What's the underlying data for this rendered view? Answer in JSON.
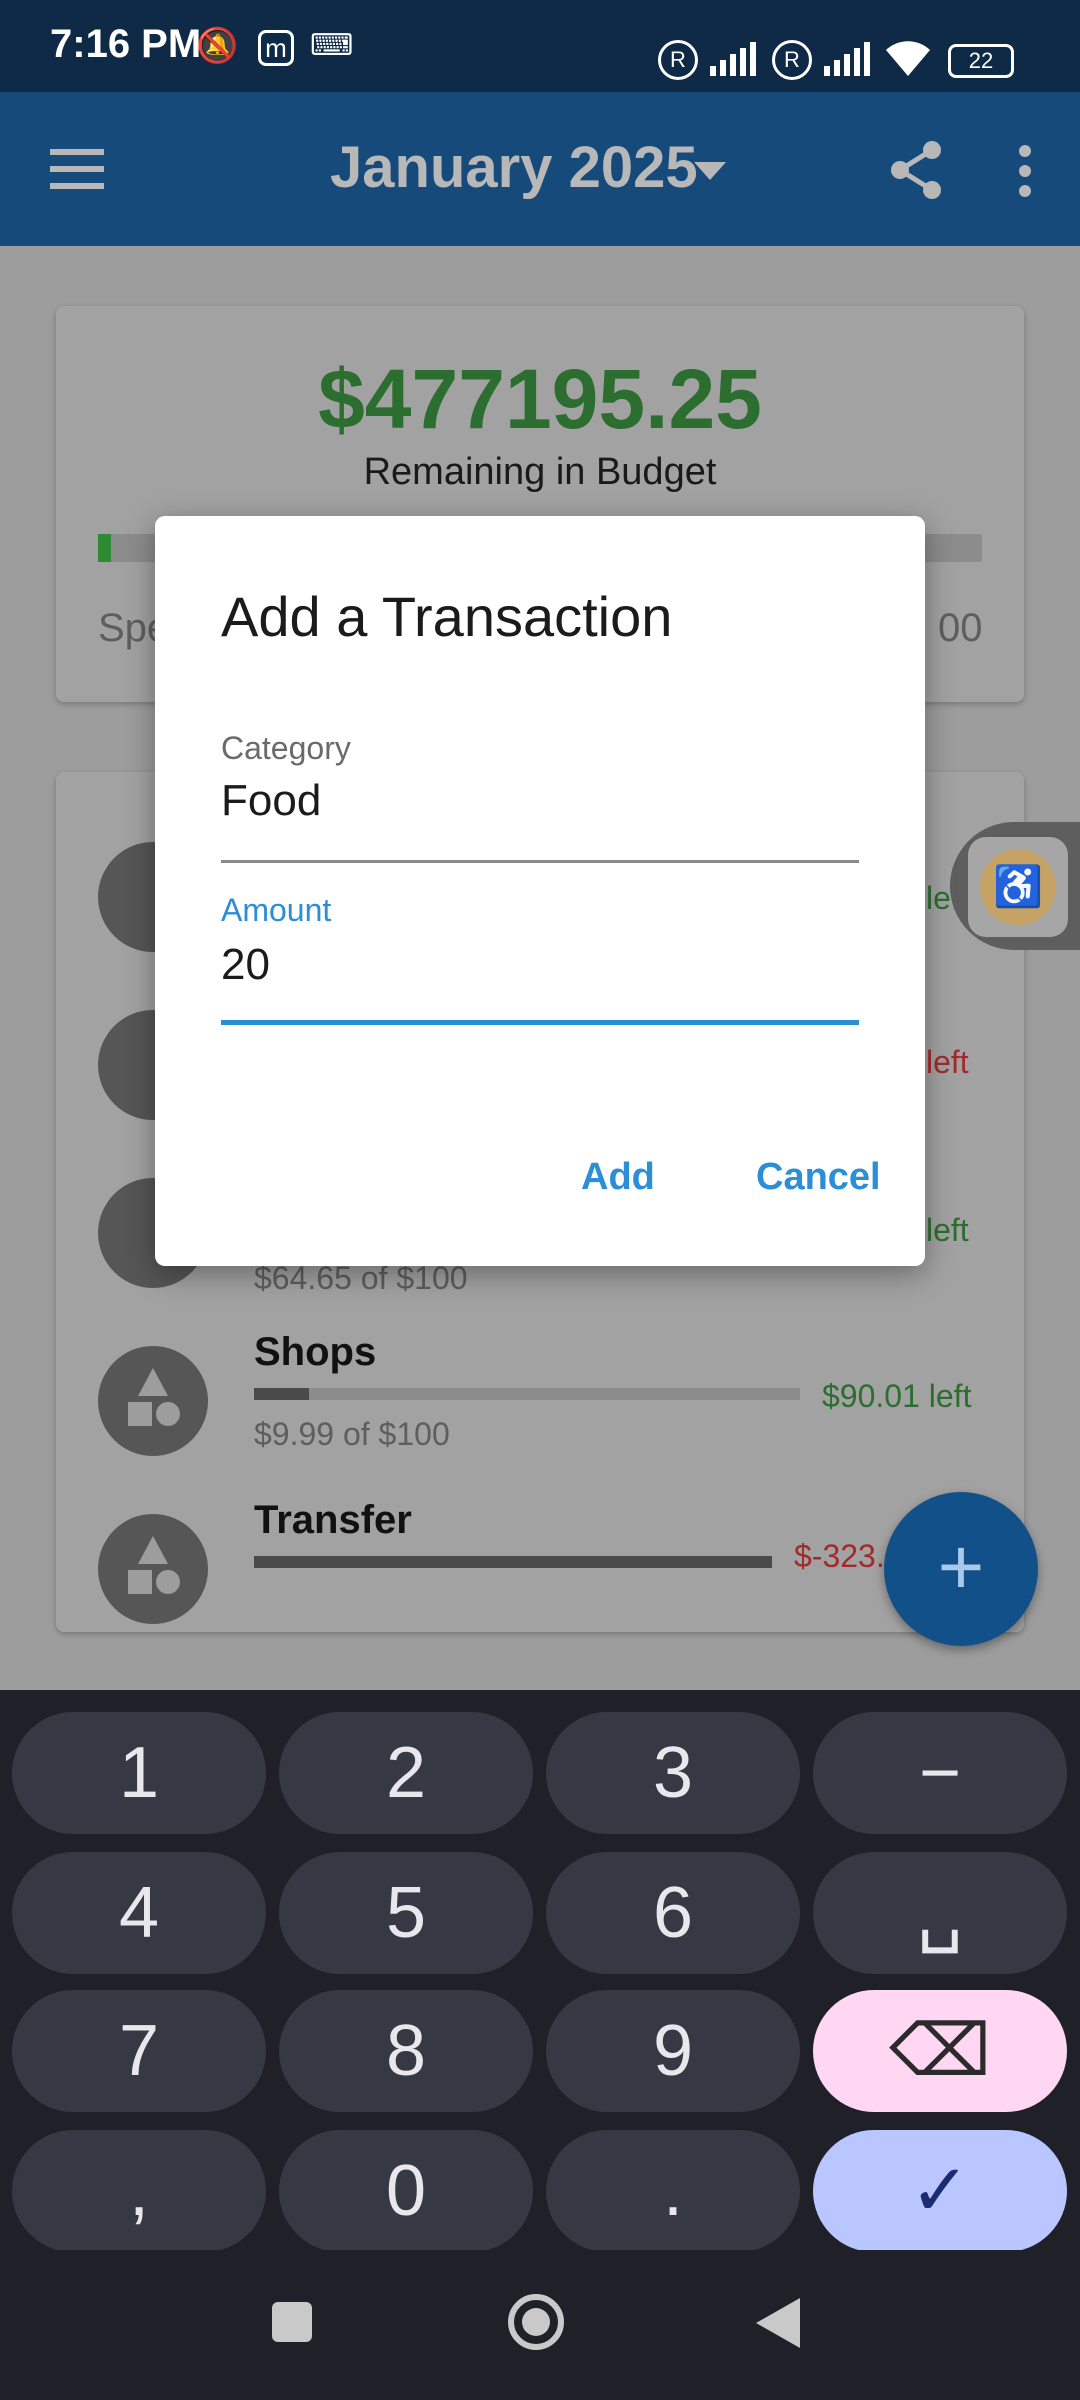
{
  "status_bar": {
    "time": "7:16 PM",
    "battery": "22",
    "icons": [
      "mute-icon",
      "mi-icon",
      "keyboard-icon",
      "registered-icon",
      "signal-icon",
      "registered-icon",
      "signal-icon",
      "wifi-icon",
      "battery-icon"
    ]
  },
  "app_bar": {
    "title": "January 2025",
    "icons": [
      "menu-icon",
      "dropdown-caret-icon",
      "share-icon",
      "more-vert-icon"
    ]
  },
  "summary": {
    "remaining": "$477195.25",
    "remaining_label": "Remaining in Budget",
    "spent_partial": "Spe",
    "total_partial": "00",
    "progress": 0.015
  },
  "categories": [
    {
      "left": "left",
      "left_color": "#2c6e2f"
    },
    {
      "left": "left",
      "left_color": "#a32a2a"
    },
    {
      "left": "left",
      "left_color": "#2c6e2f",
      "spent_text": "$64.65 of $100"
    },
    {
      "name": "Shops",
      "spent_text": "$9.99 of $100",
      "left": "$90.01 left",
      "left_color": "#2c6e2f",
      "progress": 0.1
    },
    {
      "name": "Transfer",
      "left": "$-323.",
      "left_color": "#a32a2a",
      "progress": 1.0
    }
  ],
  "dialog": {
    "title": "Add a Transaction",
    "category_label": "Category",
    "category_value": "Food",
    "amount_label": "Amount",
    "amount_value": "20",
    "add_label": "Add",
    "cancel_label": "Cancel"
  },
  "fab": {
    "label": "+"
  },
  "keyboard": {
    "row1": [
      "1",
      "2",
      "3",
      "−"
    ],
    "row2": [
      "4",
      "5",
      "6",
      "␣"
    ],
    "row3": [
      "7",
      "8",
      "9",
      "⌫"
    ],
    "row4": [
      ",",
      "0",
      ".",
      "✓"
    ]
  }
}
